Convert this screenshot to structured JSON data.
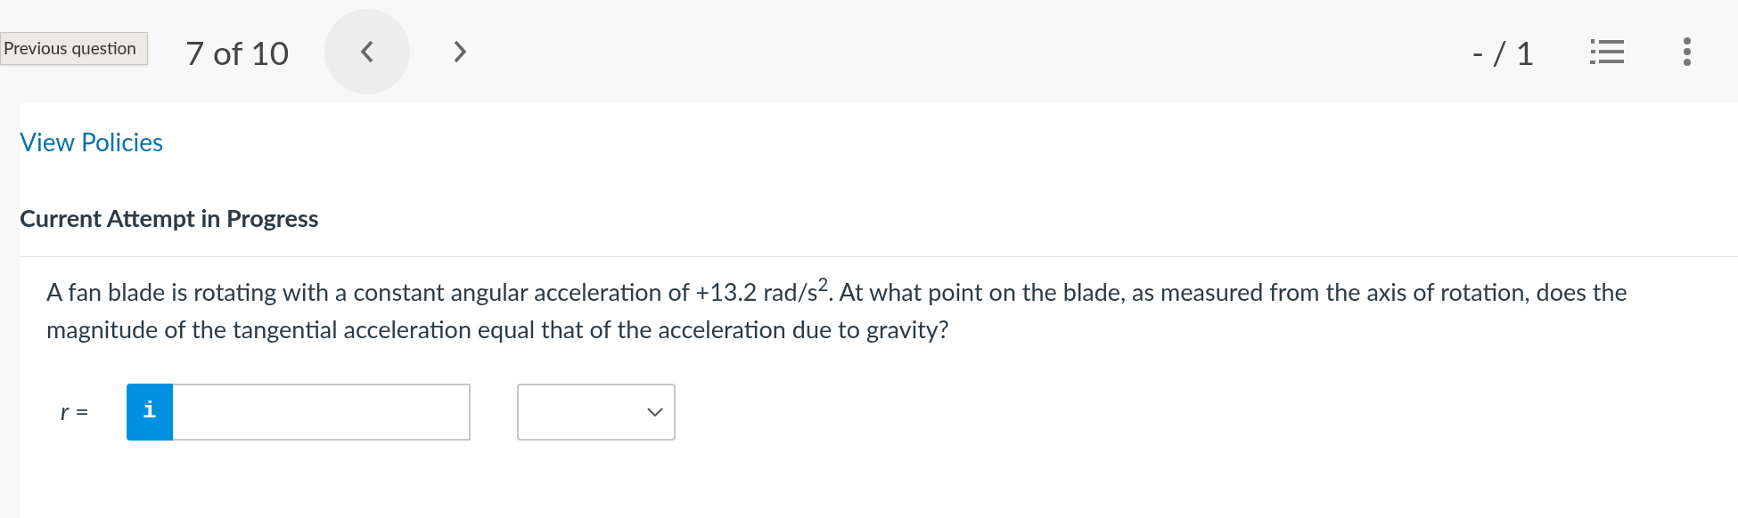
{
  "header": {
    "title": "7 of 10",
    "tooltip": "Previous question",
    "score": "- / 1"
  },
  "policies_link": "View Policies",
  "attempt_heading": "Current Attempt in Progress",
  "question": "A fan blade is rotating with a constant angular acceleration of +13.2 rad/s$^{2}$. At what point on the blade, as measured from the axis of rotation, does the magnitude of the tangential acceleration equal that of the acceleration due to gravity?",
  "answer": {
    "variable": "r",
    "equals": "=",
    "info_glyph": "i"
  }
}
